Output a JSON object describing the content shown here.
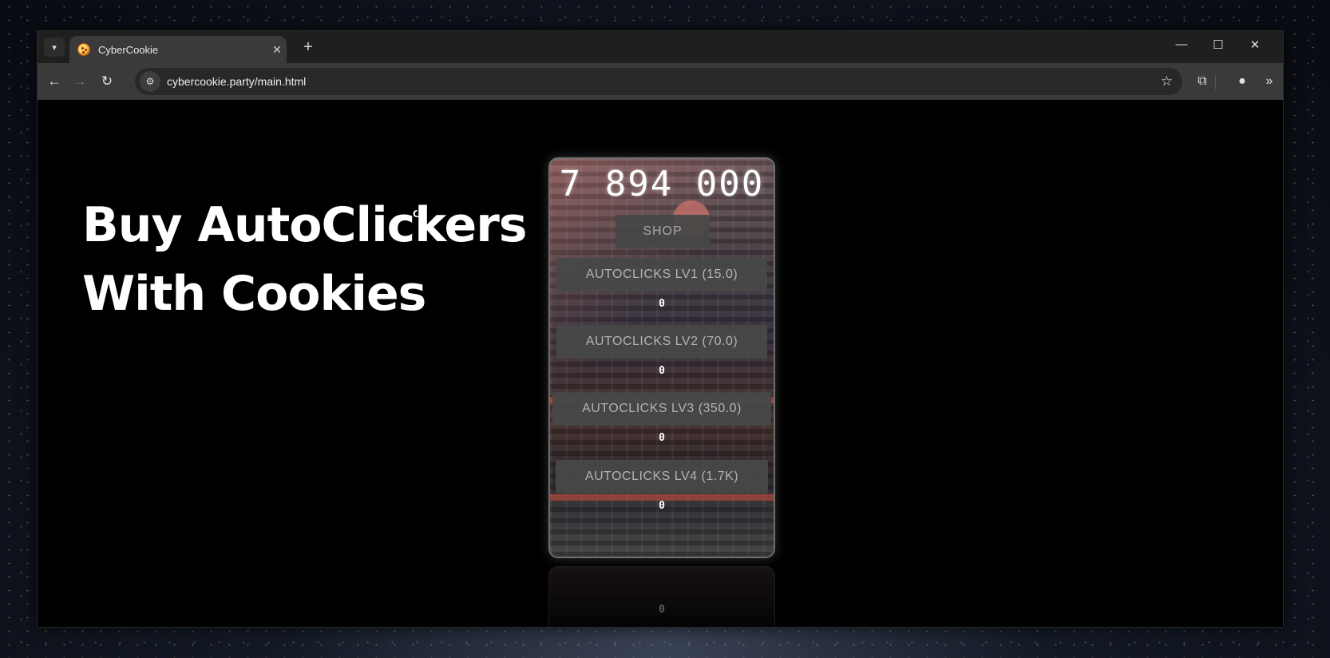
{
  "browser": {
    "tab_title": "CyberCookie",
    "new_tab": "+",
    "url": "cybercookie.party/main.html"
  },
  "page": {
    "headline_line1": "Buy AutoClickers",
    "headline_line2": "With Cookies"
  },
  "game": {
    "cookie_count": "7 894 000",
    "shop_label": "SHOP",
    "upgrades": [
      {
        "label": "AUTOCLICKS LV1 (15.0)",
        "owned": "0"
      },
      {
        "label": "AUTOCLICKS LV2 (70.0)",
        "owned": "0"
      },
      {
        "label": "AUTOCLICKS LV3 (350.0)",
        "owned": "0"
      },
      {
        "label": "AUTOCLICKS LV4 (1.7K)",
        "owned": "0"
      }
    ],
    "reflection_count": "0"
  },
  "colors": {
    "page_bg": "#000000",
    "button_bg": "#484848",
    "button_text": "#b3b3b3",
    "headline": "#ffffff"
  }
}
